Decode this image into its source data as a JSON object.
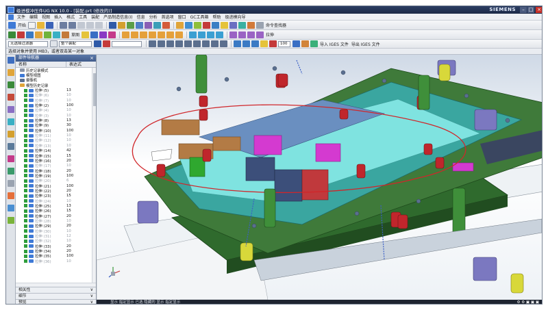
{
  "window": {
    "title": "级进模冲压件UG NX 10.0 - [装配.prt (修改的)]",
    "brand": "SIEMENS",
    "minimize_glyph": "–",
    "maximize_glyph": "□",
    "close_glyph": "×"
  },
  "menu": [
    "文件",
    "编辑",
    "视图",
    "插入",
    "格式",
    "工具",
    "装配",
    "产品制造信息(I)",
    "信息",
    "分析",
    "首选项",
    "窗口",
    "GC工具箱",
    "帮助",
    "级进模向导"
  ],
  "toolbar": {
    "tb1_labels": [
      "开始",
      "命令查找器"
    ],
    "tb2_labels": [
      "草图",
      "拉伸"
    ],
    "filter_combo": "无选择过滤器",
    "assembly_combo": "整个装配",
    "zoom_value": "100",
    "import_iges": "导入 IGES 文件",
    "export_iges": "导出 IGES 文件"
  },
  "statusline": "选择对象并使用 MB3，或者双击某一对象",
  "navigator": {
    "title": "部件导航器",
    "close_glyph": "×",
    "col_name": "名称",
    "col_value": "表达式",
    "nodes": [
      {
        "label": "历史记录模式",
        "value": "",
        "dim": false,
        "indent": 1,
        "icon": "history-icon"
      },
      {
        "label": "模型视图",
        "value": "",
        "dim": false,
        "indent": 1,
        "icon": "model-view-icon"
      },
      {
        "label": "摄像机",
        "value": "",
        "dim": false,
        "indent": 1,
        "icon": "camera-icon"
      },
      {
        "label": "模型历史记录",
        "value": "",
        "dim": false,
        "indent": 1,
        "icon": "model-history-icon"
      },
      {
        "label": "拉伸 (5)",
        "value": "13",
        "dim": false,
        "indent": 2
      },
      {
        "label": "拉伸 (6)",
        "value": "10",
        "dim": true,
        "indent": 2
      },
      {
        "label": "拉伸 (7)",
        "value": "10",
        "dim": true,
        "indent": 2
      },
      {
        "label": "拉伸 (2)",
        "value": "100",
        "dim": false,
        "indent": 2
      },
      {
        "label": "拉伸 (4)",
        "value": "10",
        "dim": true,
        "indent": 2
      },
      {
        "label": "拉伸 (3)",
        "value": "10",
        "dim": true,
        "indent": 2
      },
      {
        "label": "拉伸 (8)",
        "value": "13",
        "dim": false,
        "indent": 2
      },
      {
        "label": "拉伸 (9)",
        "value": "30",
        "dim": false,
        "indent": 2
      },
      {
        "label": "拉伸 (10)",
        "value": "100",
        "dim": false,
        "indent": 2
      },
      {
        "label": "拉伸 (11)",
        "value": "10",
        "dim": true,
        "indent": 2
      },
      {
        "label": "拉伸 (12)",
        "value": "10",
        "dim": true,
        "indent": 2
      },
      {
        "label": "拉伸 (13)",
        "value": "10",
        "dim": true,
        "indent": 2
      },
      {
        "label": "拉伸 (14)",
        "value": "42",
        "dim": false,
        "indent": 2
      },
      {
        "label": "拉伸 (15)",
        "value": "15",
        "dim": false,
        "indent": 2
      },
      {
        "label": "拉伸 (16)",
        "value": "20",
        "dim": false,
        "indent": 2
      },
      {
        "label": "拉伸 (17)",
        "value": "10",
        "dim": true,
        "indent": 2
      },
      {
        "label": "拉伸 (18)",
        "value": "20",
        "dim": false,
        "indent": 2
      },
      {
        "label": "拉伸 (19)",
        "value": "100",
        "dim": false,
        "indent": 2
      },
      {
        "label": "拉伸 (20)",
        "value": "6",
        "dim": true,
        "indent": 2
      },
      {
        "label": "拉伸 (21)",
        "value": "100",
        "dim": false,
        "indent": 2
      },
      {
        "label": "拉伸 (22)",
        "value": "20",
        "dim": false,
        "indent": 2
      },
      {
        "label": "拉伸 (23)",
        "value": "15",
        "dim": false,
        "indent": 2
      },
      {
        "label": "拉伸 (24)",
        "value": "10",
        "dim": true,
        "indent": 2
      },
      {
        "label": "拉伸 (25)",
        "value": "13",
        "dim": false,
        "indent": 2
      },
      {
        "label": "拉伸 (26)",
        "value": "15",
        "dim": false,
        "indent": 2
      },
      {
        "label": "拉伸 (27)",
        "value": "20",
        "dim": false,
        "indent": 2
      },
      {
        "label": "拉伸 (28)",
        "value": "10",
        "dim": true,
        "indent": 2
      },
      {
        "label": "拉伸 (29)",
        "value": "20",
        "dim": false,
        "indent": 2
      },
      {
        "label": "拉伸 (30)",
        "value": "10",
        "dim": true,
        "indent": 2
      },
      {
        "label": "拉伸 (31)",
        "value": "12",
        "dim": true,
        "indent": 2
      },
      {
        "label": "拉伸 (32)",
        "value": "10",
        "dim": true,
        "indent": 2
      },
      {
        "label": "拉伸 (33)",
        "value": "20",
        "dim": false,
        "indent": 2
      },
      {
        "label": "拉伸 (34)",
        "value": "20",
        "dim": false,
        "indent": 2
      },
      {
        "label": "拉伸 (35)",
        "value": "100",
        "dim": false,
        "indent": 2
      },
      {
        "label": "拉伸 (36)",
        "value": "10",
        "dim": true,
        "indent": 2
      }
    ],
    "bottom_sections": [
      "相关性",
      "细节",
      "预览"
    ],
    "chevron": "∨"
  },
  "graphics": {
    "status_text": "显示 指定显示 已选 隐藏的 显示 指定显示",
    "right_status": "⚙ ⚙ ▣ ▣ ▣"
  },
  "colors": {
    "base_plate": "#3f7a3a",
    "die_plate": "#3aa6a0",
    "cyan_insert": "#7fe3e0",
    "red_spring": "#c0262c",
    "yellow_pin": "#d8d83a",
    "purple_block": "#7b78c0",
    "magenta_insert": "#d43ad0"
  }
}
